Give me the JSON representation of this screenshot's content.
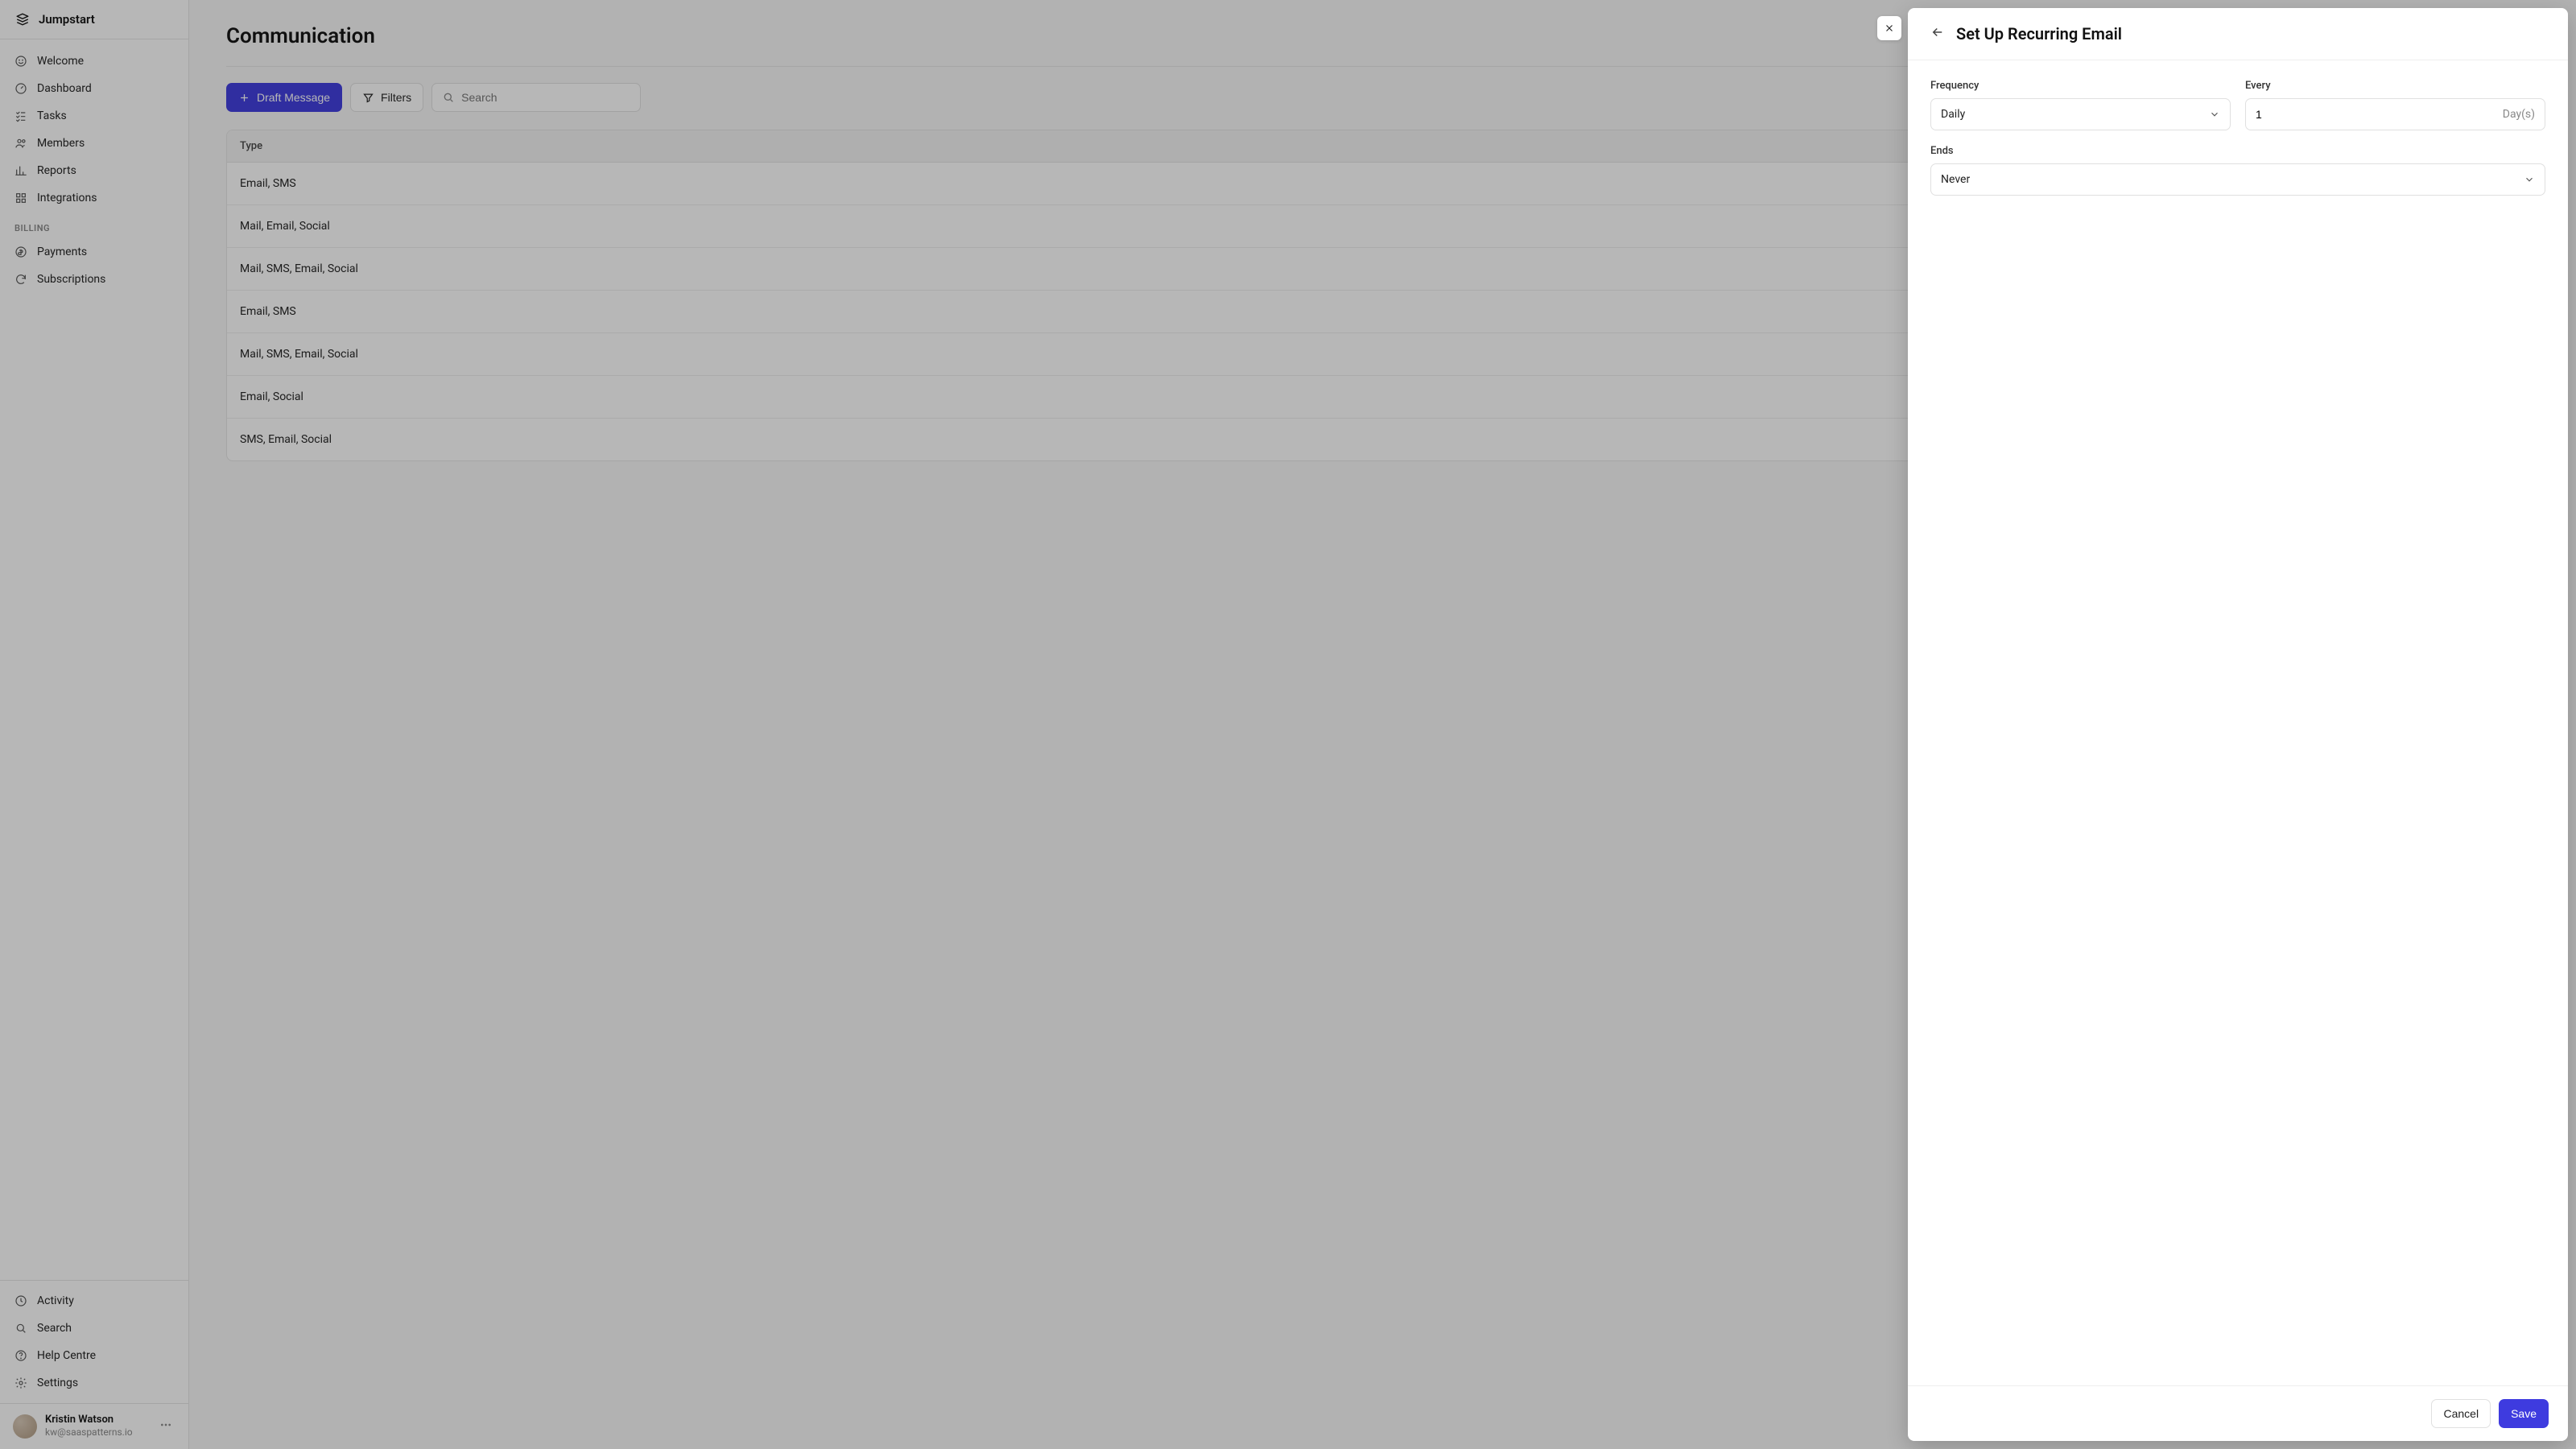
{
  "brand": "Jumpstart",
  "sidebar": {
    "main": [
      {
        "label": "Welcome"
      },
      {
        "label": "Dashboard"
      },
      {
        "label": "Tasks"
      },
      {
        "label": "Members"
      },
      {
        "label": "Reports"
      },
      {
        "label": "Integrations"
      }
    ],
    "billing_label": "BILLING",
    "billing": [
      {
        "label": "Payments"
      },
      {
        "label": "Subscriptions"
      }
    ],
    "bottom": [
      {
        "label": "Activity"
      },
      {
        "label": "Search"
      },
      {
        "label": "Help Centre"
      },
      {
        "label": "Settings"
      }
    ]
  },
  "user": {
    "name": "Kristin Watson",
    "email": "kw@saaspatterns.io"
  },
  "page": {
    "title": "Communication",
    "draft_label": "Draft Message",
    "filters_label": "Filters",
    "search_placeholder": "Search"
  },
  "table": {
    "header": "Type",
    "rows": [
      "Email, SMS",
      "Mail, Email, Social",
      "Mail, SMS, Email, Social",
      "Email, SMS",
      "Mail, SMS, Email, Social",
      "Email, Social",
      "SMS, Email, Social"
    ]
  },
  "panel": {
    "title": "Set Up Recurring Email",
    "frequency_label": "Frequency",
    "frequency_value": "Daily",
    "every_label": "Every",
    "every_value": "1",
    "every_unit": "Day(s)",
    "ends_label": "Ends",
    "ends_value": "Never",
    "cancel_label": "Cancel",
    "save_label": "Save"
  }
}
